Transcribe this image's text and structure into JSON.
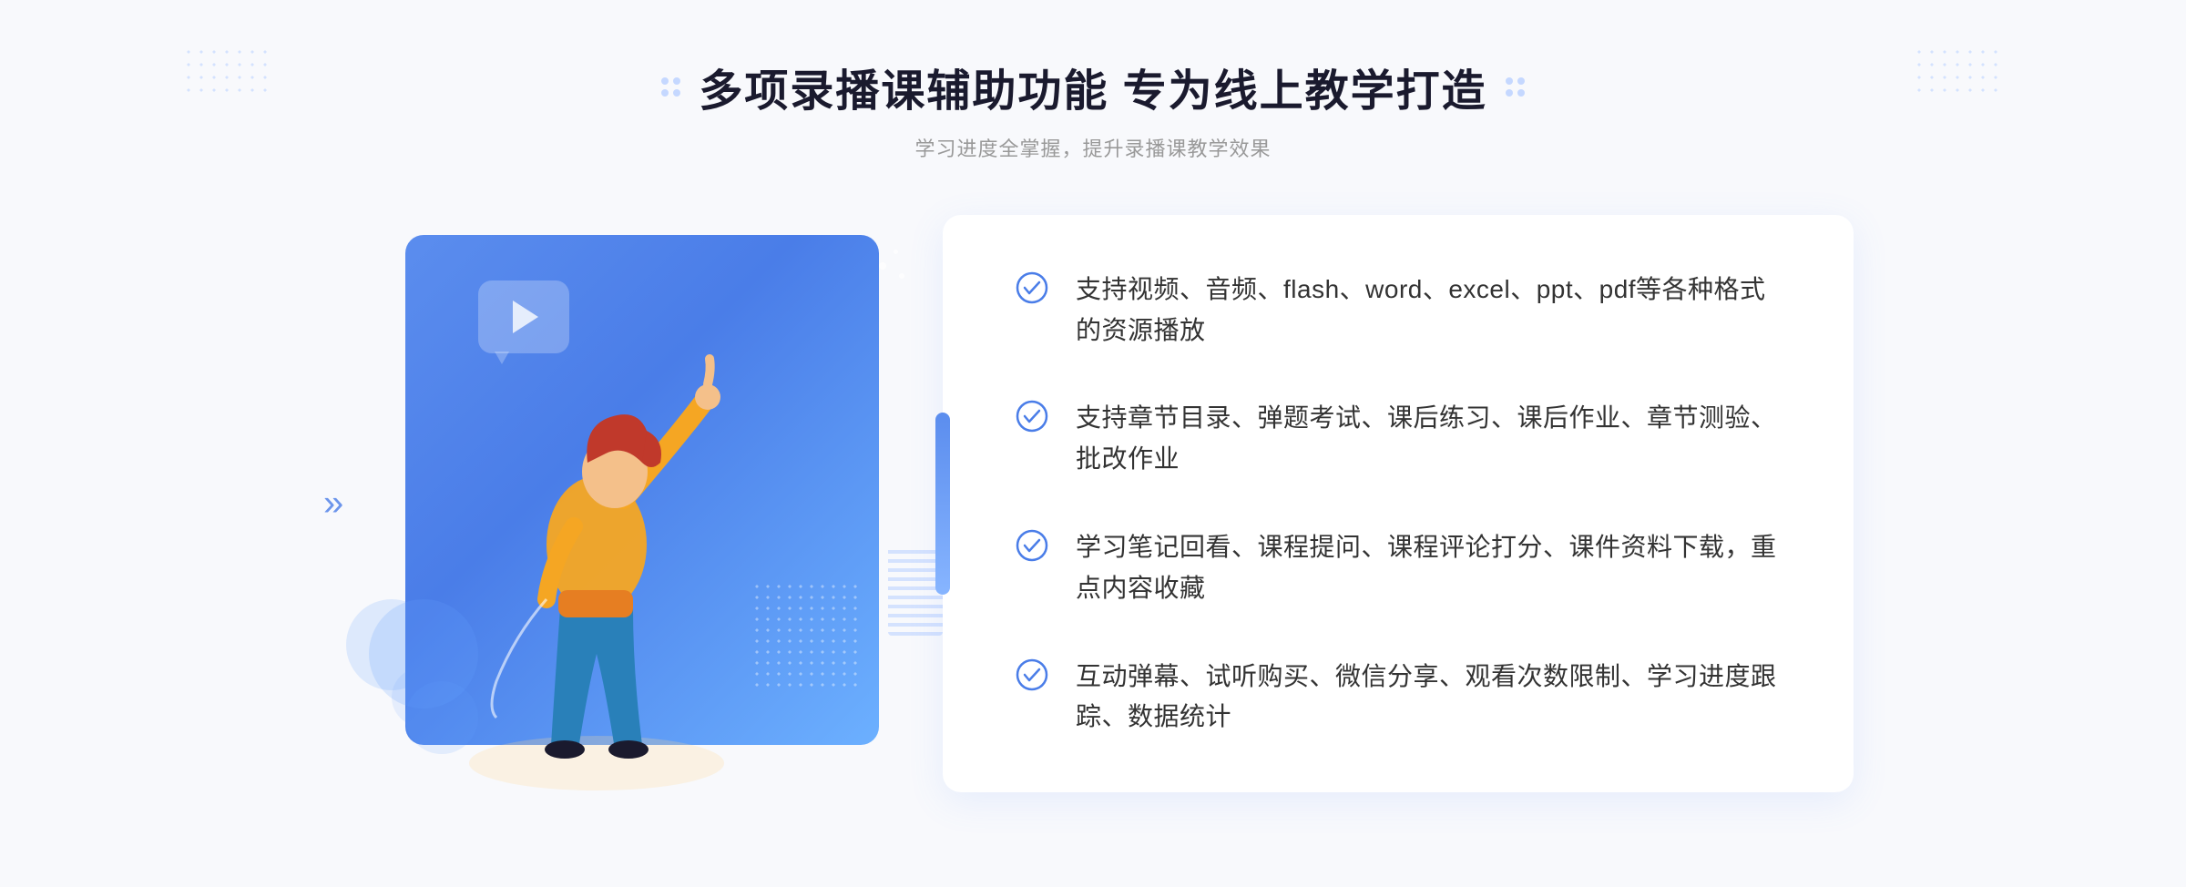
{
  "header": {
    "title": "多项录播课辅助功能 专为线上教学打造",
    "subtitle": "学习进度全掌握，提升录播课教学效果"
  },
  "features": [
    {
      "id": "feature-1",
      "text": "支持视频、音频、flash、word、excel、ppt、pdf等各种格式的资源播放"
    },
    {
      "id": "feature-2",
      "text": "支持章节目录、弹题考试、课后练习、课后作业、章节测验、批改作业"
    },
    {
      "id": "feature-3",
      "text": "学习笔记回看、课程提问、课程评论打分、课件资料下载，重点内容收藏"
    },
    {
      "id": "feature-4",
      "text": "互动弹幕、试听购买、微信分享、观看次数限制、学习进度跟踪、数据统计"
    }
  ],
  "decorations": {
    "chevrons": "»",
    "check_symbol": "✓"
  }
}
